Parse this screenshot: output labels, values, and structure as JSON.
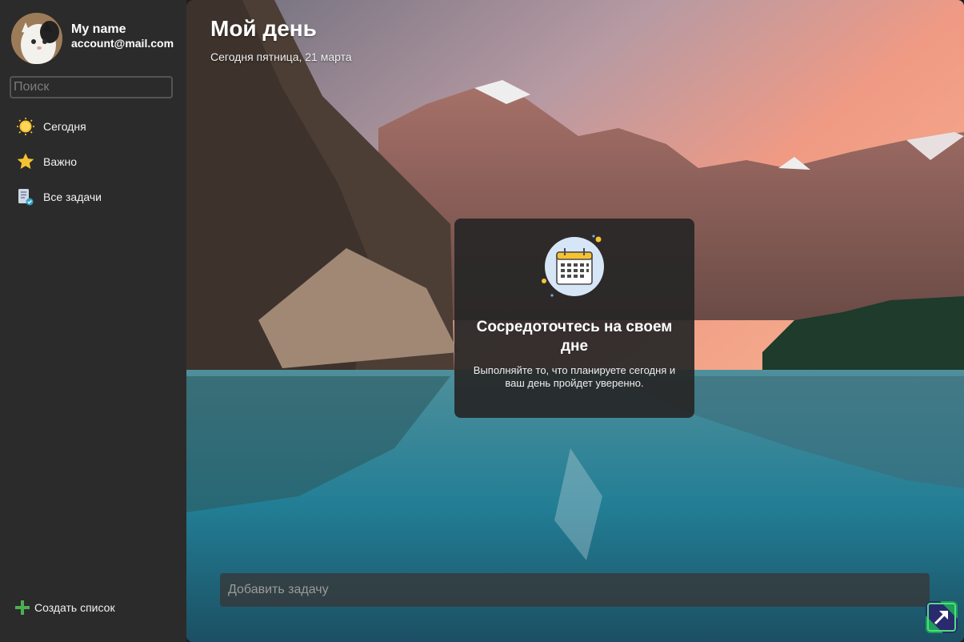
{
  "profile": {
    "name": "My name",
    "email": "account@mail.com"
  },
  "search": {
    "placeholder": "Поиск"
  },
  "sidebar": {
    "items": [
      {
        "label": "Сегодня",
        "icon": "sun-icon"
      },
      {
        "label": "Важно",
        "icon": "star-icon"
      },
      {
        "label": "Все задачи",
        "icon": "task-list-icon"
      }
    ],
    "create_list_label": "Создать список"
  },
  "main": {
    "title": "Мой день",
    "subtitle": "Сегодня пятница, 21 марта",
    "empty_state": {
      "heading": "Сосредоточтесь на своем дне",
      "text": "Выполняйте то, что планируете сегодня и ваш день пройдет уверенно."
    },
    "add_task_placeholder": "Добавить задачу"
  },
  "colors": {
    "sidebar_bg": "#2b2b2b",
    "accent_green": "#4caf50",
    "sun_yellow": "#f6c232"
  }
}
